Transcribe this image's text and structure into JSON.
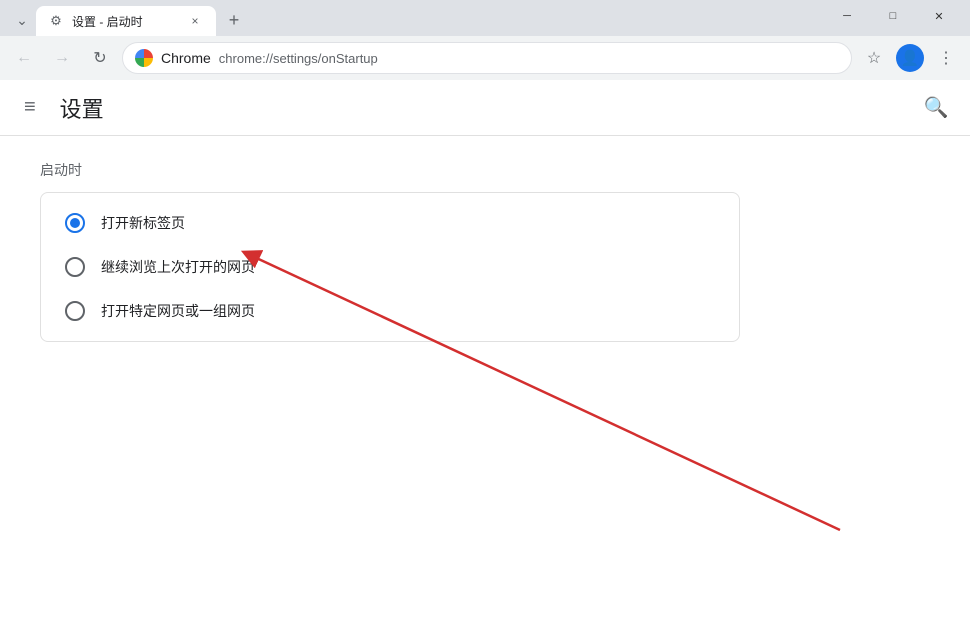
{
  "window": {
    "title": "设置 - 启动时",
    "tab_close_label": "×",
    "tab_new_label": "+",
    "controls": {
      "minimize": "─",
      "maximize": "□",
      "close": "✕"
    }
  },
  "nav": {
    "back_icon": "←",
    "forward_icon": "→",
    "reload_icon": "↻",
    "brand": "Chrome",
    "url": "chrome://settings/onStartup",
    "bookmark_icon": "☆",
    "profile_icon": "👤",
    "menu_icon": "⋮"
  },
  "settings": {
    "menu_icon": "≡",
    "title": "设置",
    "search_icon": "🔍",
    "section_title": "启动时",
    "options": [
      {
        "id": "option-new-tab",
        "label": "打开新标签页",
        "selected": true
      },
      {
        "id": "option-continue",
        "label": "继续浏览上次打开的网页",
        "selected": false
      },
      {
        "id": "option-specific",
        "label": "打开特定网页或一组网页",
        "selected": false
      }
    ]
  }
}
